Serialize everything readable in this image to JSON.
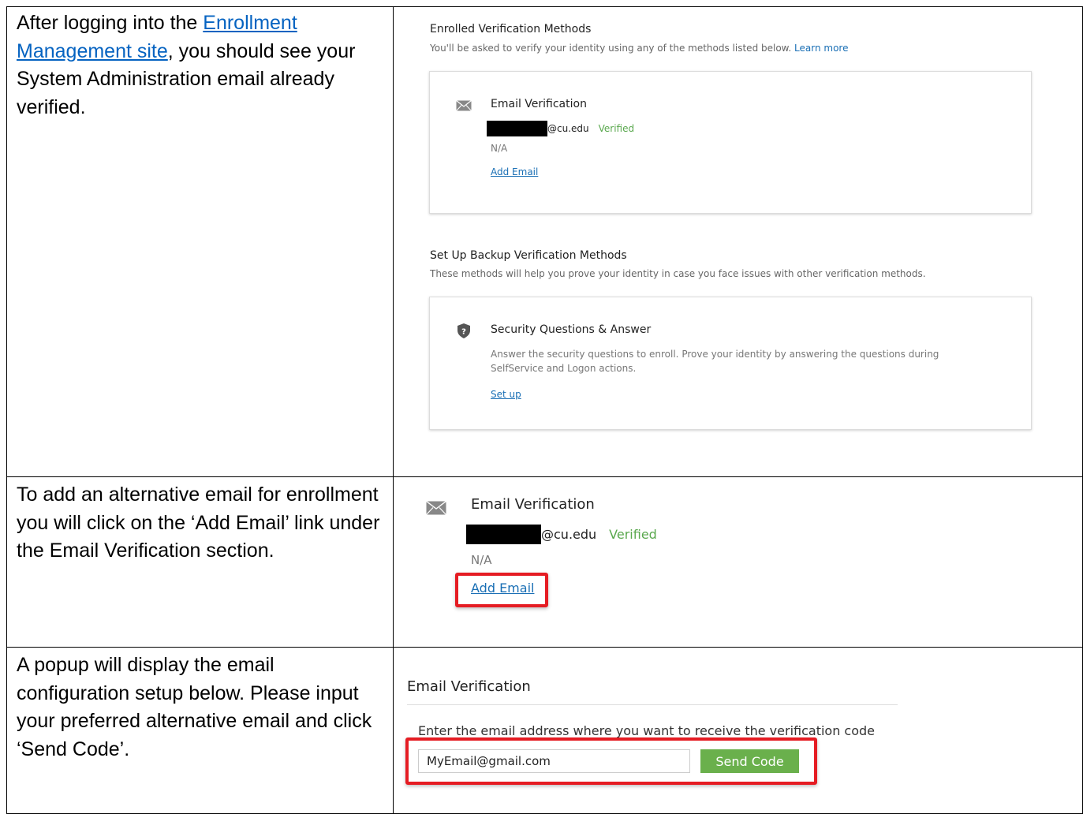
{
  "rows": [
    {
      "instruction": {
        "before": "After logging into the ",
        "link": "Enrollment Management site",
        "after": ", you should see your System Administration email already verified."
      }
    },
    {
      "instruction": "To add an alternative email for enrollment you will click on the ‘Add Email’ link under the Email Verification section."
    },
    {
      "instruction": "A popup will display the email configuration setup below. Please input your preferred alternative email and click ‘Send Code’."
    }
  ],
  "enrolled": {
    "title": "Enrolled Verification Methods",
    "subtitle": "You'll be asked to verify your identity using any of the methods listed below.",
    "learn_more": "Learn more",
    "email_method": {
      "icon": "envelope-icon",
      "title": "Email Verification",
      "email_domain": "@cu.edu",
      "status": "Verified",
      "secondary": "N/A",
      "add_link": "Add Email"
    }
  },
  "backup": {
    "title": "Set Up Backup Verification Methods",
    "subtitle": "These methods will help you prove your identity in case you face issues with other verification methods.",
    "security_method": {
      "icon": "shield-question-icon",
      "title": "Security Questions & Answer",
      "description_1": "Answer the security questions to enroll. Prove your identity by answering the questions during",
      "description_2": "SelfService and Logon actions.",
      "setup_link": "Set up"
    }
  },
  "popup": {
    "title": "Email Verification",
    "prompt": "Enter the email address where you want to receive the verification code",
    "input_value": "MyEmail@gmail.com",
    "button": "Send Code"
  },
  "colors": {
    "link": "#1a6fb5",
    "verified": "#5aa84e",
    "button": "#6ab04c",
    "highlight": "#e51c23"
  }
}
